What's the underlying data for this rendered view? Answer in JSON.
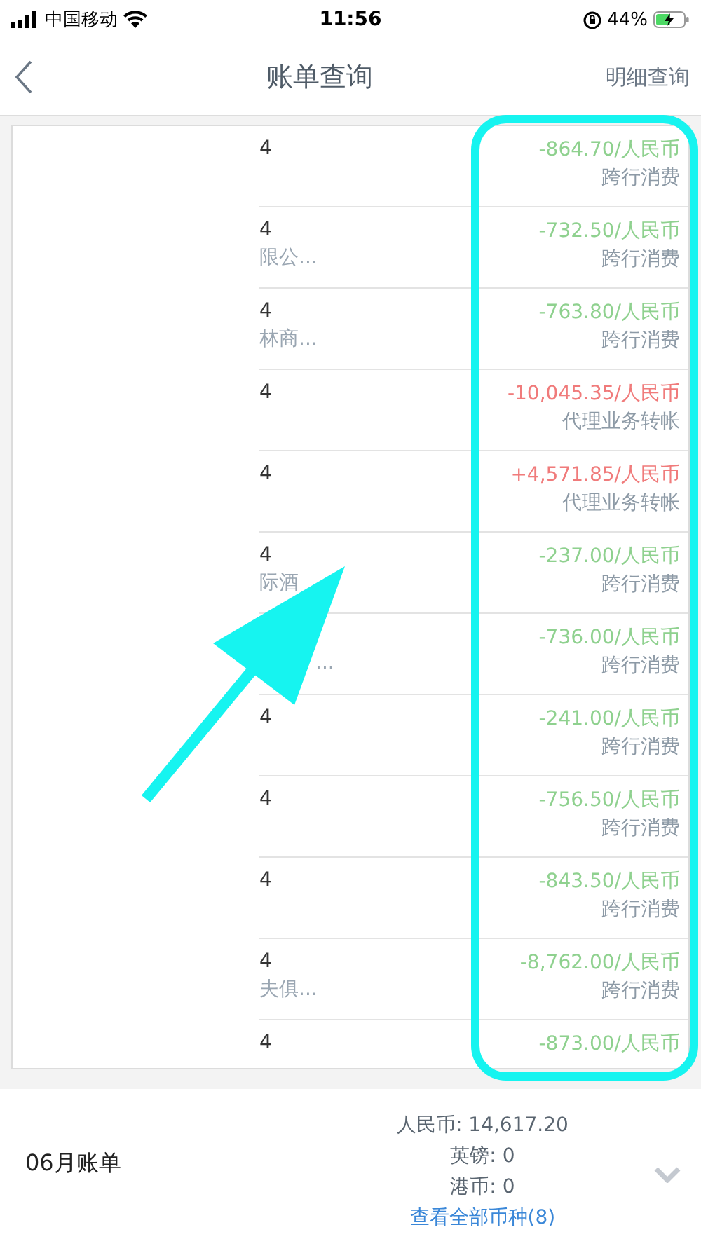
{
  "status_bar": {
    "carrier": "中国移动",
    "time": "11:56",
    "battery": "44%"
  },
  "nav": {
    "title": "账单查询",
    "action": "明细查询"
  },
  "transactions": [
    {
      "count": "4",
      "amount": "-864.70/人民币",
      "kind": "debit",
      "type_label": "跨行消费"
    },
    {
      "count": "4",
      "merchant": "限公...",
      "amount": "-732.50/人民币",
      "kind": "debit",
      "type_label": "跨行消费"
    },
    {
      "count": "4",
      "merchant": "林商...",
      "amount": "-763.80/人民币",
      "kind": "debit",
      "type_label": "跨行消费"
    },
    {
      "count": "4",
      "amount": "-10,045.35/人民币",
      "kind": "credit",
      "type_label": "代理业务转帐"
    },
    {
      "count": "4",
      "amount": "+4,571.85/人民币",
      "kind": "credit",
      "type_label": "代理业务转帐"
    },
    {
      "count": "4",
      "merchant": "际酒",
      "amount": "-237.00/人民币",
      "kind": "debit",
      "type_label": "跨行消费"
    },
    {
      "merchant": "...",
      "amount": "-736.00/人民币",
      "kind": "debit",
      "type_label": "跨行消费"
    },
    {
      "count": "4",
      "amount": "-241.00/人民币",
      "kind": "debit",
      "type_label": "跨行消费"
    },
    {
      "count": "4",
      "amount": "-756.50/人民币",
      "kind": "debit",
      "type_label": "跨行消费"
    },
    {
      "count": "4",
      "amount": "-843.50/人民币",
      "kind": "debit",
      "type_label": "跨行消费"
    },
    {
      "count": "4",
      "merchant": "夫俱...",
      "amount": "-8,762.00/人民币",
      "kind": "debit",
      "type_label": "跨行消费"
    },
    {
      "count": "4",
      "amount": "-873.00/人民币",
      "kind": "debit"
    }
  ],
  "summary": {
    "month": "06月账单",
    "totals": [
      "人民币: 14,617.20",
      "英镑: 0",
      "港币: 0"
    ],
    "link": "查看全部币种(8)"
  }
}
